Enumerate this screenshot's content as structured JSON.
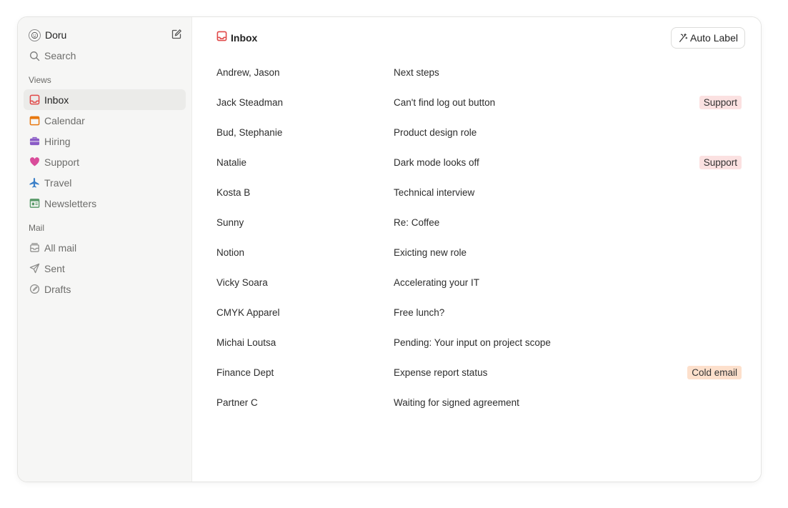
{
  "user": {
    "name": "Doru"
  },
  "search": {
    "label": "Search"
  },
  "views": {
    "label": "Views",
    "items": [
      {
        "label": "Inbox",
        "icon": "inbox-icon",
        "color": "#e04848",
        "active": true
      },
      {
        "label": "Calendar",
        "icon": "calendar-icon",
        "color": "#e8780f"
      },
      {
        "label": "Hiring",
        "icon": "briefcase-icon",
        "color": "#8b5cc7"
      },
      {
        "label": "Support",
        "icon": "heart-icon",
        "color": "#d94c9a"
      },
      {
        "label": "Travel",
        "icon": "airplane-icon",
        "color": "#3b80c8"
      },
      {
        "label": "Newsletters",
        "icon": "newspaper-icon",
        "color": "#5a9a6a"
      }
    ]
  },
  "mail": {
    "label": "Mail",
    "items": [
      {
        "label": "All mail",
        "icon": "archive-icon"
      },
      {
        "label": "Sent",
        "icon": "send-icon"
      },
      {
        "label": "Drafts",
        "icon": "draft-icon"
      }
    ]
  },
  "main": {
    "title": "Inbox",
    "auto_label": "Auto Label",
    "messages": [
      {
        "from": "Andrew, Jason",
        "subject": "Next steps",
        "tag": ""
      },
      {
        "from": "Jack Steadman",
        "subject": "Can't find log out button",
        "tag": "Support"
      },
      {
        "from": "Bud, Stephanie",
        "subject": "Product design role",
        "tag": ""
      },
      {
        "from": "Natalie",
        "subject": "Dark mode looks off",
        "tag": "Support"
      },
      {
        "from": "Kosta B",
        "subject": "Technical interview",
        "tag": ""
      },
      {
        "from": "Sunny",
        "subject": "Re: Coffee",
        "tag": ""
      },
      {
        "from": "Notion",
        "subject": "Exicting new role",
        "tag": ""
      },
      {
        "from": "Vicky Soara",
        "subject": "Accelerating your IT",
        "tag": ""
      },
      {
        "from": "CMYK Apparel",
        "subject": "Free lunch?",
        "tag": ""
      },
      {
        "from": "Michai Loutsa",
        "subject": "Pending: Your input on project scope",
        "tag": ""
      },
      {
        "from": "Finance Dept",
        "subject": "Expense report status",
        "tag": "Cold email"
      },
      {
        "from": "Partner C",
        "subject": "Waiting for signed agreement",
        "tag": ""
      }
    ]
  }
}
